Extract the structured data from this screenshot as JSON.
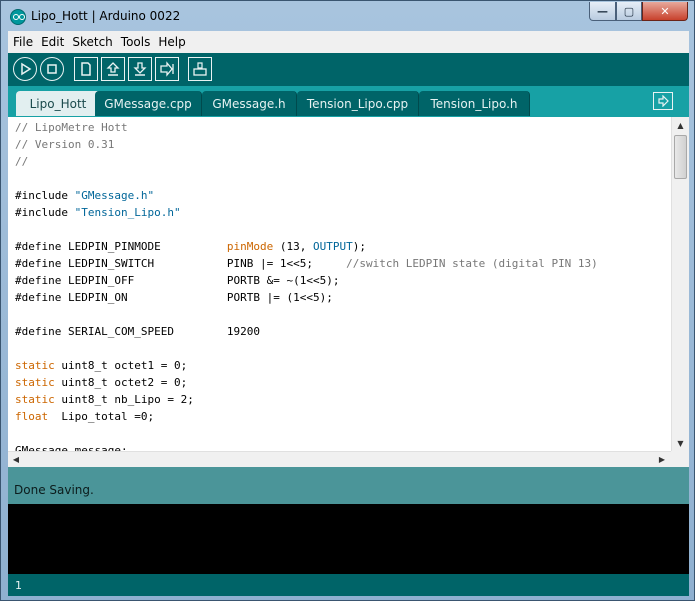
{
  "window": {
    "title": "Lipo_Hott | Arduino 0022",
    "controls": {
      "minimize": "—",
      "maximize": "▢",
      "close": "✕"
    }
  },
  "menu": [
    "File",
    "Edit",
    "Sketch",
    "Tools",
    "Help"
  ],
  "toolbar": {
    "buttons": [
      "verify",
      "stop",
      "new",
      "open",
      "save",
      "upload",
      "serial-monitor"
    ],
    "icons": [
      "play-icon",
      "stop-icon",
      "new-file-icon",
      "open-icon",
      "save-icon",
      "upload-icon",
      "serial-monitor-icon"
    ]
  },
  "tabs": [
    {
      "label": "Lipo_Hott",
      "active": true
    },
    {
      "label": "GMessage.cpp",
      "active": false
    },
    {
      "label": "GMessage.h",
      "active": false
    },
    {
      "label": "Tension_Lipo.cpp",
      "active": false
    },
    {
      "label": "Tension_Lipo.h",
      "active": false
    }
  ],
  "editor": {
    "lines": [
      [
        {
          "t": "// LipoMetre Hott",
          "c": "cmt"
        }
      ],
      [
        {
          "t": "// Version 0.31",
          "c": "cmt"
        }
      ],
      [
        {
          "t": "//",
          "c": "cmt"
        }
      ],
      [
        {
          "t": "",
          "c": ""
        }
      ],
      [
        {
          "t": "#include ",
          "c": ""
        },
        {
          "t": "\"GMessage.h\"",
          "c": "str"
        }
      ],
      [
        {
          "t": "#include ",
          "c": ""
        },
        {
          "t": "\"Tension_Lipo.h\"",
          "c": "str"
        }
      ],
      [
        {
          "t": "",
          "c": ""
        }
      ],
      [
        {
          "t": "#define LEDPIN_PINMODE          ",
          "c": ""
        },
        {
          "t": "pinMode",
          "c": "kw"
        },
        {
          "t": " (13, ",
          "c": ""
        },
        {
          "t": "OUTPUT",
          "c": "const"
        },
        {
          "t": ");",
          "c": ""
        }
      ],
      [
        {
          "t": "#define LEDPIN_SWITCH           PINB |= 1<<5;     ",
          "c": ""
        },
        {
          "t": "//switch LEDPIN state (digital PIN 13)",
          "c": "cmt"
        }
      ],
      [
        {
          "t": "#define LEDPIN_OFF              PORTB &= ~(1<<5);",
          "c": ""
        }
      ],
      [
        {
          "t": "#define LEDPIN_ON               PORTB |= (1<<5);",
          "c": ""
        }
      ],
      [
        {
          "t": "",
          "c": ""
        }
      ],
      [
        {
          "t": "#define SERIAL_COM_SPEED        19200",
          "c": ""
        }
      ],
      [
        {
          "t": "",
          "c": ""
        }
      ],
      [
        {
          "t": "static",
          "c": "kw"
        },
        {
          "t": " uint8_t octet1 = 0;",
          "c": ""
        }
      ],
      [
        {
          "t": "static",
          "c": "kw"
        },
        {
          "t": " uint8_t octet2 = 0;",
          "c": ""
        }
      ],
      [
        {
          "t": "static",
          "c": "kw"
        },
        {
          "t": " uint8_t nb_Lipo = 2;",
          "c": ""
        }
      ],
      [
        {
          "t": "float",
          "c": "kw"
        },
        {
          "t": "  Lipo_total =0;",
          "c": ""
        }
      ],
      [
        {
          "t": "",
          "c": ""
        }
      ],
      [
        {
          "t": "GMessage message;",
          "c": ""
        }
      ]
    ]
  },
  "status": {
    "message": "Done Saving."
  },
  "line_indicator": "1",
  "colors": {
    "toolbar": "#006468",
    "tabbar": "#17a1a5",
    "status": "#4b9599",
    "console": "#000000"
  }
}
